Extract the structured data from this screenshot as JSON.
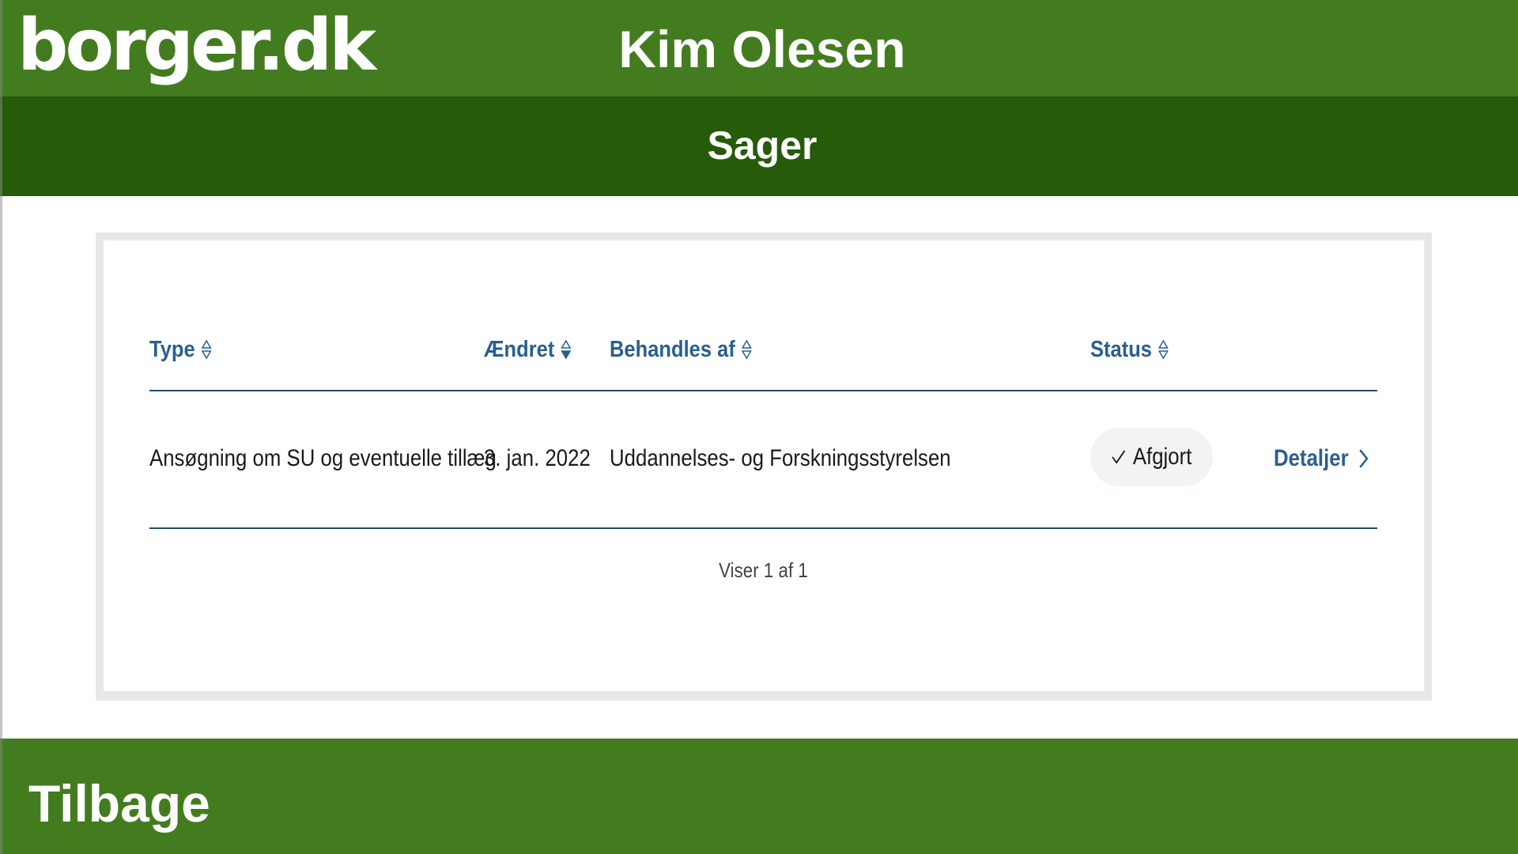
{
  "header": {
    "logo_text": "borger.dk",
    "user_name": "Kim Olesen"
  },
  "subheader": {
    "title": "Sager"
  },
  "table": {
    "columns": [
      {
        "label": "Type",
        "sort": "none"
      },
      {
        "label": "Ændret",
        "sort": "descending"
      },
      {
        "label": "Behandles af",
        "sort": "none"
      },
      {
        "label": "Status",
        "sort": "none"
      }
    ],
    "rows": [
      {
        "type": "Ansøgning om SU og eventuelle tillæg",
        "changed": "3. jan. 2022",
        "handled_by": "Uddannelses- og Forskningsstyrelsen",
        "status": "Afgjort",
        "status_icon": "check-icon",
        "details_label": "Detaljer",
        "details_icon": "chevron-right-icon"
      }
    ],
    "pager": "Viser 1 af 1"
  },
  "footer": {
    "back_label": "Tilbage"
  },
  "colors": {
    "primary_green": "#437c1f",
    "dark_green": "#265b09",
    "link_blue": "#2b5f8e",
    "divider": "#264e6e"
  }
}
